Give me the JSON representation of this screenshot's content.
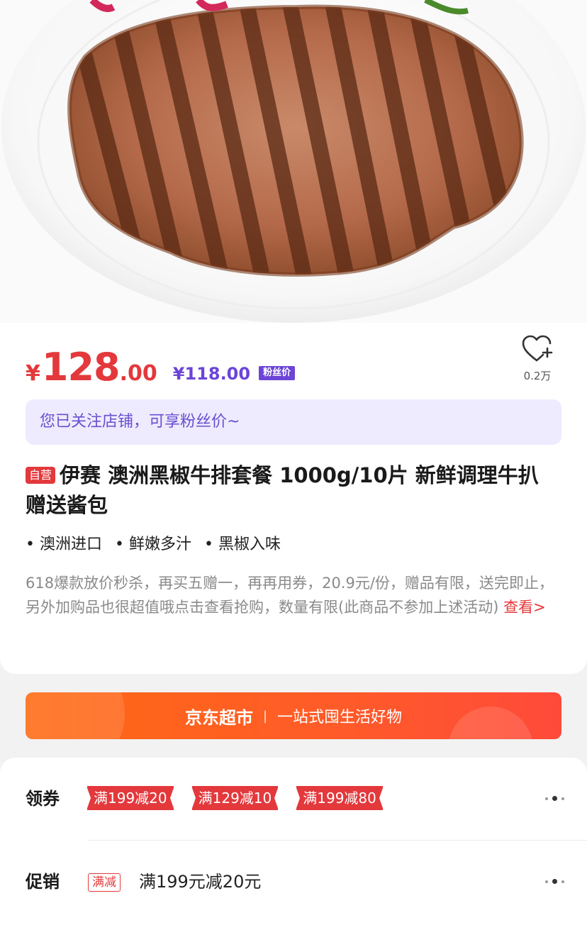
{
  "product": {
    "price_currency": "¥",
    "price_int": "128",
    "price_dec": ".00",
    "fans_price": "¥118.00",
    "fans_badge": "粉丝价",
    "follow_count": "0.2万",
    "fan_notice": "您已关注店铺，可享粉丝价~",
    "self_operated_tag": "自营",
    "title": "伊赛 澳洲黑椒牛排套餐 1000g/10片 新鲜调理牛扒 赠送酱包",
    "features": [
      "澳洲进口",
      "鲜嫩多汁",
      "黑椒入味"
    ],
    "description": "618爆款放价秒杀，再买五赠一，再再用券，20.9元/份，赠品有限，送完即止，另外加购品也很超值哦点击查看抢购，数量有限(此商品不参加上述活动)",
    "description_link": "查看>"
  },
  "banner": {
    "brand": "京东超市",
    "separator": "|",
    "slogan": "一站式囤生活好物"
  },
  "coupons": {
    "label": "领券",
    "items": [
      "满199减20",
      "满129减10",
      "满199减80"
    ]
  },
  "promotion": {
    "label": "促销",
    "tag": "满减",
    "text": "满199元减20元"
  },
  "icons": {
    "follow": "heart-plus-icon",
    "more": "more-dots-icon"
  },
  "colors": {
    "price_red": "#e4393c",
    "fans_purple": "#6c44d8",
    "banner_orange": "#ff6a12"
  }
}
